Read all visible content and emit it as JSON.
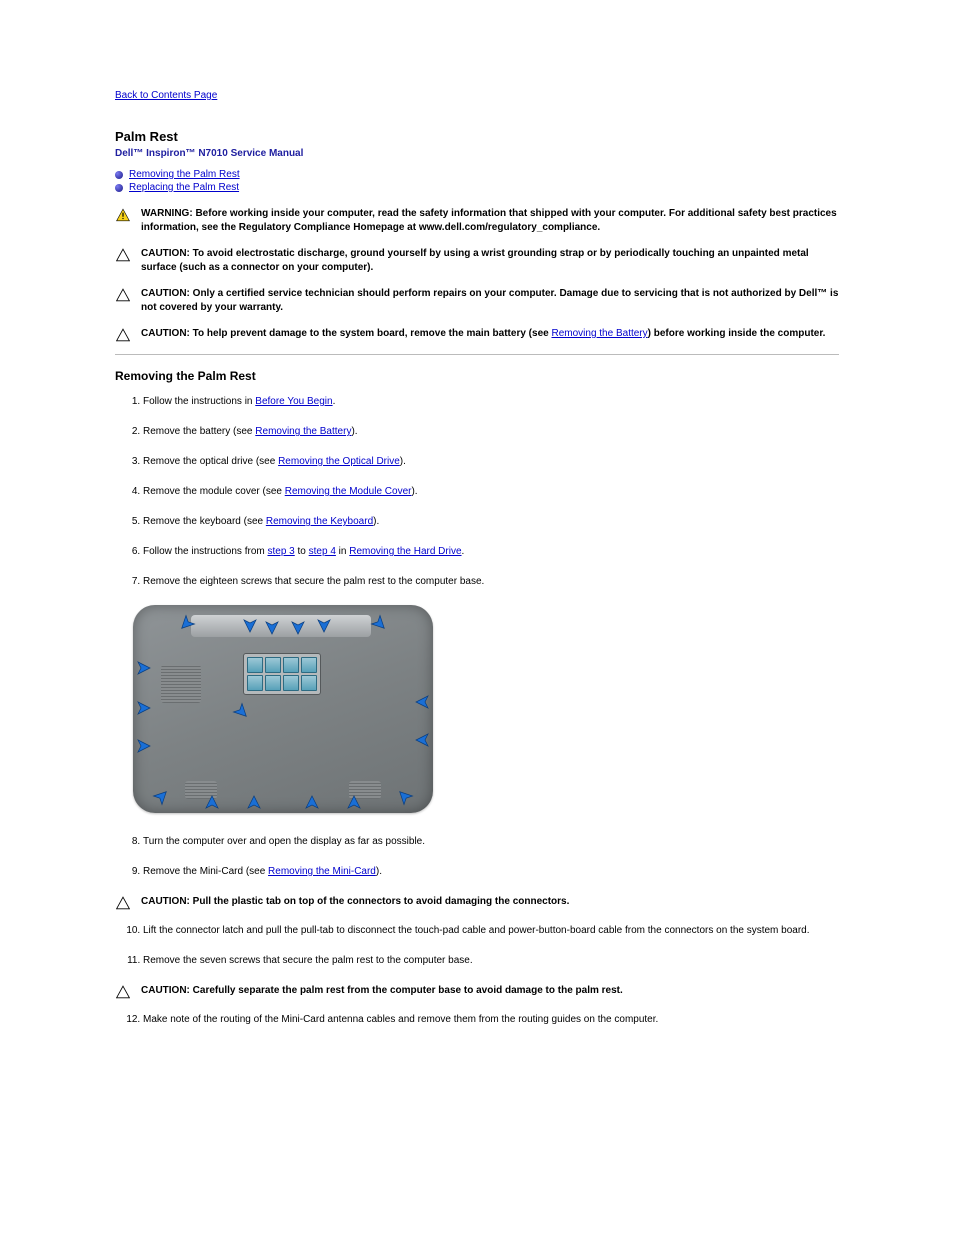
{
  "nav": {
    "back": "Back to Contents Page"
  },
  "header": {
    "page_title": "Palm Rest",
    "manual_title": "Dell™ Inspiron™ N7010 Service Manual"
  },
  "jumps": [
    {
      "label": "Removing the Palm Rest"
    },
    {
      "label": "Replacing the Palm Rest"
    }
  ],
  "notices": {
    "warning": {
      "lead": "WARNING: ",
      "body": "Before working inside your computer, read the safety information that shipped with your computer. For additional safety best practices information, see the Regulatory Compliance Homepage at www.dell.com/regulatory_compliance."
    },
    "caution_esd": {
      "lead": "CAUTION: ",
      "body": "To avoid electrostatic discharge, ground yourself by using a wrist grounding strap or by periodically touching an unpainted metal surface (such as a connector on your computer)."
    },
    "caution_tech": {
      "lead": "CAUTION: ",
      "body_prefix": "Only a certified service technician should perform repairs on your computer. Damage due to servicing that is not authorized by Dell™ ",
      "body_suffix": "is not covered by your warranty."
    },
    "caution_board": {
      "lead": "CAUTION: ",
      "body_prefix": "To help prevent damage to the system board, remove the main battery (see ",
      "link": "Removing the Battery",
      "body_suffix": ") before working inside the computer."
    }
  },
  "section_remove": {
    "heading": "Removing the Palm Rest",
    "steps": [
      {
        "prefix": "Follow the instructions in ",
        "link": "Before You Begin",
        "suffix": "."
      },
      {
        "prefix": "Remove the battery (see ",
        "link": "Removing the Battery",
        "suffix": ")."
      },
      {
        "prefix": "Remove the optical drive (see ",
        "link": "Removing the Optical Drive",
        "suffix": ")."
      },
      {
        "prefix": "Remove the module cover (see ",
        "link": "Removing the Module Cover",
        "suffix": ")."
      },
      {
        "prefix": "Remove the keyboard (see ",
        "link": "Removing the Keyboard",
        "suffix": ")."
      },
      {
        "prefix": "Follow the instructions from ",
        "link1": "step 3",
        "mid1": " to ",
        "link2": "step 4",
        "mid2": " in ",
        "link3": "Removing the Hard Drive",
        "suffix": "."
      },
      {
        "plain": "Remove the eighteen screws that secure the palm rest to the computer base."
      }
    ],
    "steps2": [
      {
        "plain": "Turn the computer over and open the display as far as possible."
      },
      {
        "prefix": "Remove the Mini-Card (see ",
        "link": "Removing the Mini-Card",
        "suffix": ")."
      }
    ],
    "caution_pull": {
      "lead": "CAUTION: ",
      "body": "Pull the plastic tab on top of the connectors to avoid damaging the connectors."
    },
    "steps3": [
      {
        "plain": "Lift the connector latch and pull the pull-tab to disconnect the touch-pad cable and power-button-board cable from the connectors on the system board."
      },
      {
        "plain": "Remove the seven screws that secure the palm rest to the computer base."
      }
    ],
    "caution_separate": {
      "lead": "CAUTION: ",
      "body": "Carefully separate the palm rest from the computer base to avoid damage to the palm rest."
    },
    "steps4": [
      {
        "plain": "Make note of the routing of the Mini-Card antenna cables and remove them from the routing guides on the computer."
      }
    ]
  }
}
